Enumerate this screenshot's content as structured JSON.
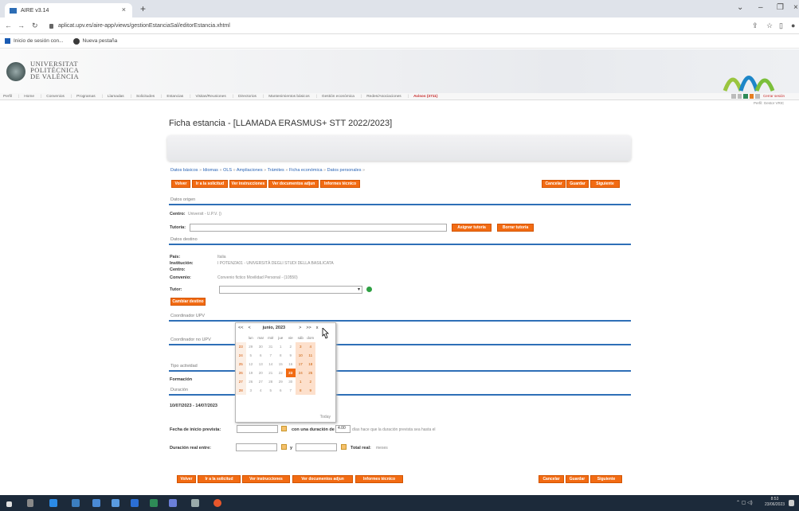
{
  "browser": {
    "tab_title": "AIRE v3.14",
    "url": "aplicat.upv.es/aire-app/views/gestionEstanciaSal/editorEstancia.xhtml",
    "bookmarks": [
      "Inicio de sesión con...",
      "Nueva pestaña"
    ]
  },
  "header": {
    "university": [
      "UNIVERSITAT",
      "POLITÈCNICA",
      "DE VALÈNCIA"
    ],
    "menu": [
      "Perfil",
      "Home",
      "Convenios",
      "Programas",
      "Llamadas",
      "Solicitudes",
      "Estancias",
      "Visitas/Reuniones",
      "Directorios",
      "Mantenimientos básicos",
      "Gestión económica",
      "Redes/Asociaciones",
      "Avisos (3711)"
    ],
    "right_link": "Cerrar sesión",
    "perfil_label": "Perfil: Gestor VRIC"
  },
  "page": {
    "title": "Ficha estancia - [LLAMADA ERASMUS+ STT 2022/2023]",
    "breadcrumb": [
      "Datos básicos",
      "Idiomas",
      "OLS",
      "Ampliaciones",
      "Trámites",
      "Ficha económica",
      "Datos personales"
    ],
    "buttons_left": [
      "Volver",
      "Ir a la solicitud",
      "Ver instrucciones",
      "Ver documentos adjun",
      "Informes técnico"
    ],
    "buttons_right": [
      "Cancelar",
      "Guardar",
      "Siguiente"
    ],
    "sections": {
      "origen": "Datos origen",
      "destino": "Datos destino",
      "coord_upv": "Coordinador UPV",
      "coord_no_upv": "Coordinador no UPV",
      "tipo": "Tipo actividad",
      "duracion": "Duración"
    },
    "origen": {
      "centro_label": "Centro:",
      "centro_value": "Universit - U.P.V. ()",
      "tutoria_label": "Tutoría:",
      "asignar": "Asignar tutoría",
      "borrar": "Borrar tutoría"
    },
    "destino": {
      "pais_label": "País:",
      "pais_value": "Italia",
      "inst_label": "Institución:",
      "inst_value": "I POTENZA01 - UNIVERSITÀ DEGLI STUDI DELLA BASILICATA",
      "centro_label": "Centro:",
      "convenio_label": "Convenio:",
      "convenio_value": "Convenio fictico Movilidad Personal - (10550)",
      "tutor_label": "Tutor:",
      "cambiar": "Cambiar destino"
    },
    "tipo_value": "Formación",
    "fechas_value": "10/07/2023 - 14/07/2023",
    "fecha_inicio_label": "Fecha de inicio prevista:",
    "con_duracion": "con una duración de",
    "duracion_val": "4.00",
    "dias_hace": "días hace que la duración prevista sea hasta el",
    "duracion_real_label": "Duración real entre:",
    "y_label": "y",
    "total_real": "Total real:",
    "meses": "meses"
  },
  "calendar": {
    "nav_prev": [
      "<<",
      "<"
    ],
    "month": "junio, 2023",
    "nav_next": [
      ">",
      ">>"
    ],
    "close": "x",
    "weekdays": [
      "lun",
      "mar",
      "mié",
      "jue",
      "vie",
      "sáb",
      "dom"
    ],
    "weeks": [
      {
        "wk": "23",
        "days": [
          "29",
          "30",
          "31",
          "1",
          "2",
          "3",
          "4"
        ]
      },
      {
        "wk": "24",
        "days": [
          "5",
          "6",
          "7",
          "8",
          "9",
          "10",
          "11"
        ]
      },
      {
        "wk": "25",
        "days": [
          "12",
          "13",
          "14",
          "15",
          "16",
          "17",
          "18"
        ]
      },
      {
        "wk": "26",
        "days": [
          "19",
          "20",
          "21",
          "22",
          "23",
          "24",
          "25"
        ]
      },
      {
        "wk": "27",
        "days": [
          "26",
          "27",
          "28",
          "29",
          "30",
          "1",
          "2"
        ]
      },
      {
        "wk": "28",
        "days": [
          "3",
          "4",
          "5",
          "6",
          "7",
          "8",
          "9"
        ]
      }
    ],
    "selected": "23",
    "today": "Today"
  },
  "taskbar": {
    "time": "8:53",
    "date": "23/06/2023"
  },
  "colors": {
    "orange": "#f26b13",
    "blue_rule": "#2e6fb7",
    "link": "#2a64b5"
  }
}
